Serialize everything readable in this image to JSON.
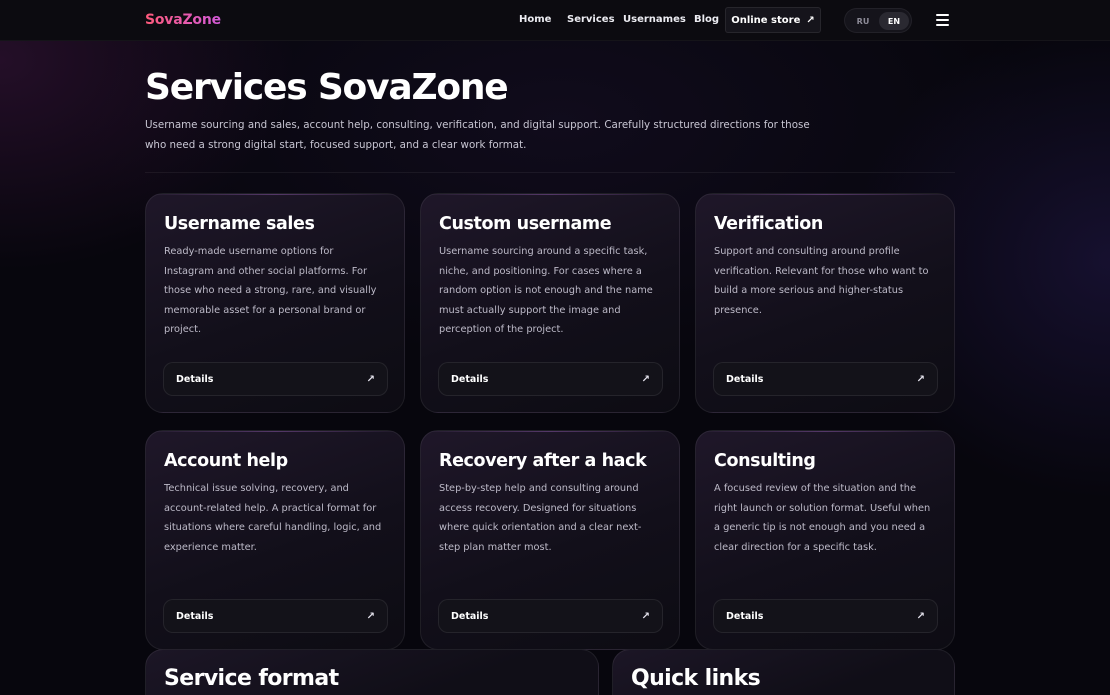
{
  "header": {
    "logo": "SovaZone",
    "nav": [
      {
        "label": "Home"
      },
      {
        "label": "Services"
      },
      {
        "label": "Usernames"
      },
      {
        "label": "Blog"
      }
    ],
    "store_button": {
      "label": "Online store",
      "icon": "arrow-up-right-icon"
    },
    "languages": [
      {
        "label": "RU",
        "active": false
      },
      {
        "label": "EN",
        "active": true
      }
    ],
    "menu_icon": "hamburger-menu-icon"
  },
  "hero": {
    "title": "Services SovaZone",
    "subtitle": "Username sourcing and sales, account help, consulting, verification, and digital support. Carefully structured directions for those who need a strong digital start, focused support, and a clear work format."
  },
  "services": [
    {
      "title": "Username sales",
      "text": "Ready-made username options for Instagram and other social platforms. For those who need a strong, rare, and visually memorable asset for a personal brand or project.",
      "button": "Details"
    },
    {
      "title": "Custom username",
      "text": "Username sourcing around a specific task, niche, and positioning. For cases where a random option is not enough and the name must actually support the image and perception of the project.",
      "button": "Details"
    },
    {
      "title": "Verification",
      "text": "Support and consulting around profile verification. Relevant for those who want to build a more serious and higher-status presence.",
      "button": "Details"
    },
    {
      "title": "Account help",
      "text": "Technical issue solving, recovery, and account-related help. A practical format for situations where careful handling, logic, and experience matter.",
      "button": "Details"
    },
    {
      "title": "Recovery after a hack",
      "text": "Step-by-step help and consulting around access recovery. Designed for situations where quick orientation and a clear next-step plan matter most.",
      "button": "Details"
    },
    {
      "title": "Consulting",
      "text": "A focused review of the situation and the right launch or solution format. Useful when a generic tip is not enough and you need a clear direction for a specific task.",
      "button": "Details"
    }
  ],
  "panels": {
    "service_format": "Service format",
    "quick_links": "Quick links"
  },
  "colors": {
    "background": "#07060d",
    "logo_gradient_start": "#ff5a7a",
    "logo_gradient_end": "#d25ad8"
  }
}
